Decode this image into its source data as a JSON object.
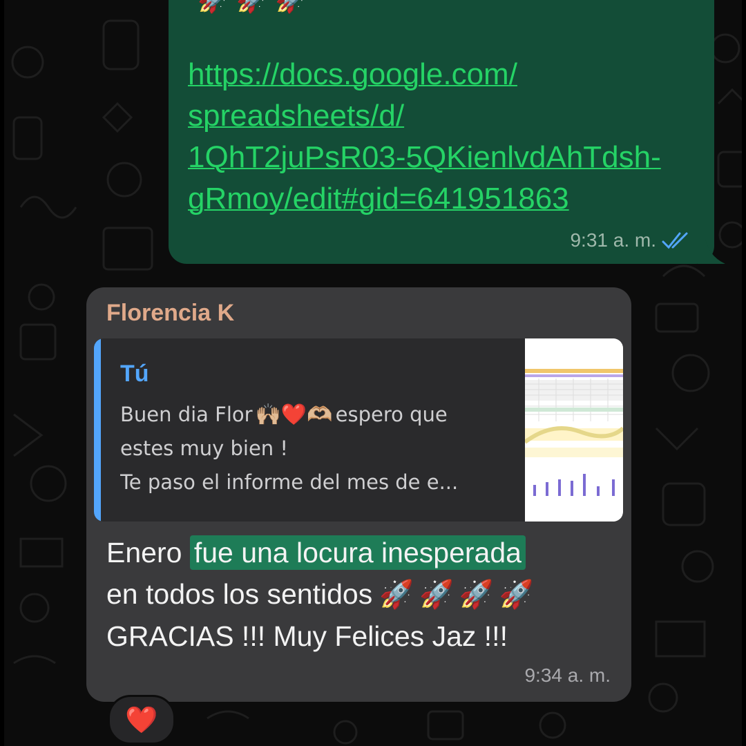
{
  "colors": {
    "outgoing_bubble": "#134d37",
    "incoming_bubble": "#3a3a3c",
    "link": "#25d366",
    "sender_name": "#e0a98a",
    "quote_author": "#53a6fd",
    "highlight": "#1e7c57"
  },
  "outgoing": {
    "top_text": "",
    "top_rockets": "🚀 🚀 🚀",
    "link_lines": [
      "https://docs.google.com/",
      "spreadsheets/d/",
      "1QhT2juPsR03-5QKienlvdAhTdsh-",
      "gRmoy/edit#gid=641951863"
    ],
    "time": "9:31 a. m.",
    "status_icon": "double-check-read-icon"
  },
  "incoming": {
    "sender": "Florencia K",
    "quote": {
      "author": "Tú",
      "line1_before": "Buen dia Flor",
      "line1_emojis": "🙌🏼❤️🫶🏼",
      "line1_after": "espero que",
      "line2": "estes muy bien !",
      "line3": "Te paso el informe del mes de e...",
      "thumbnail": "spreadsheet-thumbnail"
    },
    "message": {
      "line1_plain": "Enero ",
      "line1_highlight": "fue una locura inesperada",
      "line2": "en todos los sentidos",
      "line2_emojis": "🚀🚀🚀🚀",
      "line3": "GRACIAS !!! Muy Felices Jaz !!!"
    },
    "time": "9:34 a. m.",
    "reaction": "❤️"
  }
}
